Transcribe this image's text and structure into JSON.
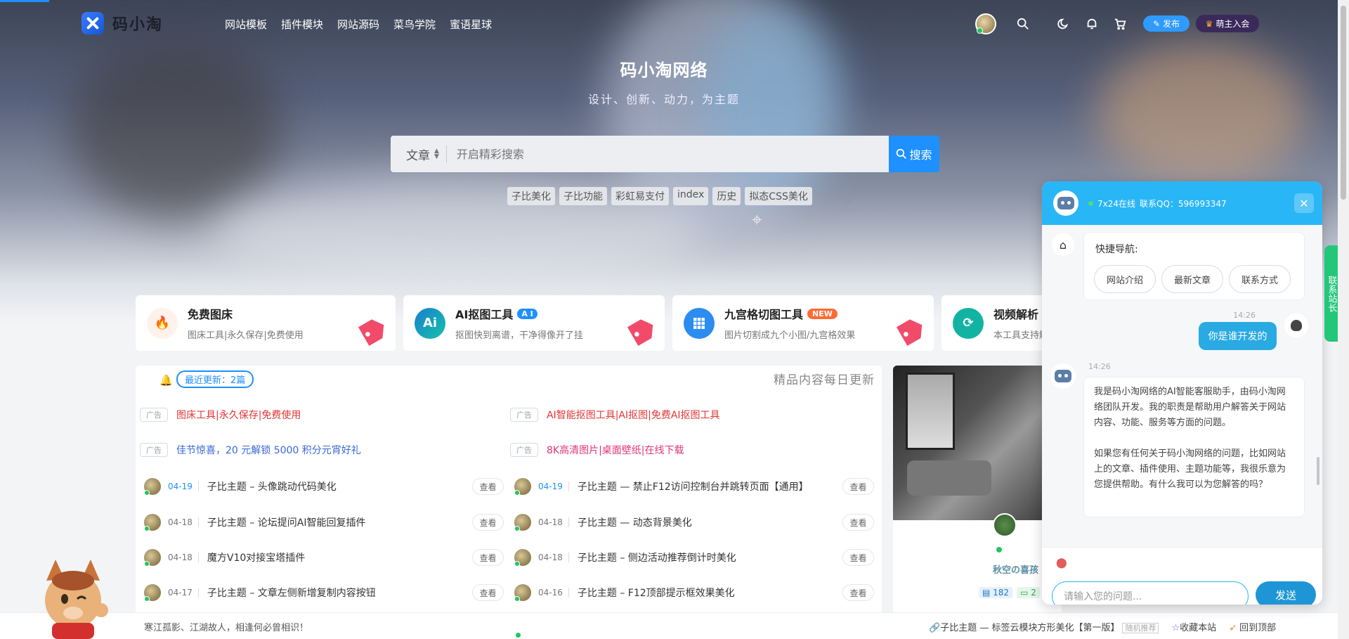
{
  "header": {
    "logo_text": "码小淘",
    "nav": [
      "网站模板",
      "插件模块",
      "网站源码",
      "菜鸟学院",
      "蜜语星球"
    ],
    "publish_label": "发布",
    "vip_label": "萌主入会"
  },
  "hero": {
    "title": "码小淘网络",
    "subtitle": "设计、创新、动力，为主题",
    "search_type": "文章",
    "search_placeholder": "开启精彩搜索",
    "search_button": "搜索",
    "tags": [
      "子比美化",
      "子比功能",
      "彩虹易支付",
      "index",
      "历史",
      "拟态CSS美化"
    ]
  },
  "cards": [
    {
      "title": "免费图床",
      "desc": "图床工具|永久保存|免费使用",
      "color": "#ff7a45"
    },
    {
      "title": "AI抠图工具",
      "badge": "A I",
      "desc": "抠图快到离谱，干净得像开了挂",
      "color": "#1aa3b8"
    },
    {
      "title": "九宫格切图工具",
      "badge": "NEW",
      "desc": "图片切割成九个小图/九宫格效果",
      "color": "#2d8cf0"
    },
    {
      "title": "视频解析",
      "desc": "本工具支持解",
      "color": "#13b3a3"
    }
  ],
  "updates": {
    "recent_label": "最近更新：2篇",
    "daily_label": "精品内容每日更新",
    "ad_label": "广告",
    "ads": [
      "图床工具|永久保存|免费使用",
      "AI智能抠图工具|AI抠图|免费AI抠图工具",
      "佳节惊喜，20 元解锁 5000 积分元宵好礼",
      "8K高清图片|桌面壁纸|在线下载"
    ],
    "view_label": "查看",
    "posts_left": [
      {
        "date": "04-19",
        "title": "子比主题 – 头像跳动代码美化"
      },
      {
        "date": "04-18",
        "title": "子比主题 – 论坛提问AI智能回复插件"
      },
      {
        "date": "04-18",
        "title": "魔方V10对接宝塔插件"
      },
      {
        "date": "04-17",
        "title": "子比主题 – 文章左侧新增复制内容按钮"
      }
    ],
    "posts_right": [
      {
        "date": "04-19",
        "title": "子比主题 — 禁止F12访问控制台并跳转页面【通用】"
      },
      {
        "date": "04-18",
        "title": "子比主题 — 动态背景美化"
      },
      {
        "date": "04-18",
        "title": "子比主题 – 侧边活动推荐倒计时美化"
      },
      {
        "date": "04-16",
        "title": "子比主题 – F12顶部提示框效果美化"
      }
    ]
  },
  "side": {
    "name": "秋空の喜孩",
    "stat_posts": "182",
    "stat_comments": "2"
  },
  "bottom": {
    "motto": "寒江孤影、江湖故人，相逢何必曾相识！",
    "link": "子比主题 — 标签云模块方形美化【第一版】",
    "link_tag": "随机推荐",
    "favorite": "收藏本站",
    "top": "回到顶部"
  },
  "chat": {
    "status": "7x24在线",
    "qq": "联系QQ：596993347",
    "quick_title": "快捷导航:",
    "quick_buttons": [
      "网站介绍",
      "最新文章",
      "联系方式"
    ],
    "user_time": "14:26",
    "user_message": "你是谁开发的",
    "bot_time": "14:26",
    "bot_p1": "我是码小淘网络的AI智能客服助手，由码小淘网络团队开发。我的职责是帮助用户解答关于网站内容、功能、服务等方面的问题。",
    "bot_p2": "如果您有任何关于码小淘网络的问题，比如网站上的文章、插件使用、主题功能等，我很乐意为您提供帮助。有什么我可以为您解答的吗？",
    "input_placeholder": "请输入您的问题...",
    "send_label": "发送"
  },
  "side_tab": "联系站长"
}
